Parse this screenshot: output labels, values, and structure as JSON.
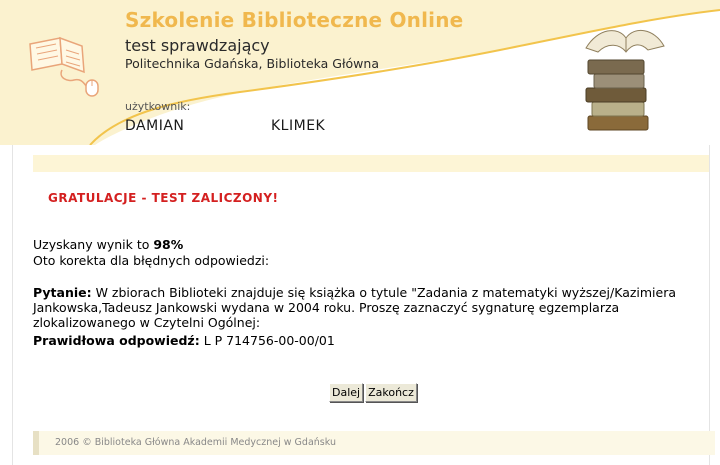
{
  "header": {
    "title": "Szkolenie Biblioteczne Online",
    "subtitle": "test sprawdzający",
    "organization": "Politechnika Gdańska, Biblioteka Główna",
    "user_label": "użytkownik:",
    "user_first_name": "DAMIAN",
    "user_last_name": "KLIMEK"
  },
  "result": {
    "congrats": "GRATULACJE - TEST ZALICZONY!",
    "score_prefix": "Uzyskany wynik to ",
    "score_value": "98%",
    "correction_intro": "Oto korekta dla błędnych odpowiedzi:"
  },
  "question": {
    "label": "Pytanie:",
    "text": " W zbiorach Biblioteki znajduje się książka o tytule \"Zadania z matematyki wyższej/Kazimiera Jankowska,Tadeusz Jankowski wydana w 2004 roku. Proszę zaznaczyć sygnaturę egzemplarza zlokalizowanego w Czytelni Ogólnej:",
    "answer_label": "Prawidłowa odpowiedź:",
    "answer_value": " L P 714756-00-00/01"
  },
  "buttons": {
    "next": "Dalej",
    "finish": "Zakończ"
  },
  "footer": {
    "text": "2006 © Biblioteka Główna Akademii Medycznej w Gdańsku"
  },
  "colors": {
    "accent": "#f0b84e",
    "header_bg": "#fbf2cf",
    "congrats": "#d42020"
  },
  "icons": [
    "book-mouse-logo-icon",
    "book-stack-icon"
  ]
}
